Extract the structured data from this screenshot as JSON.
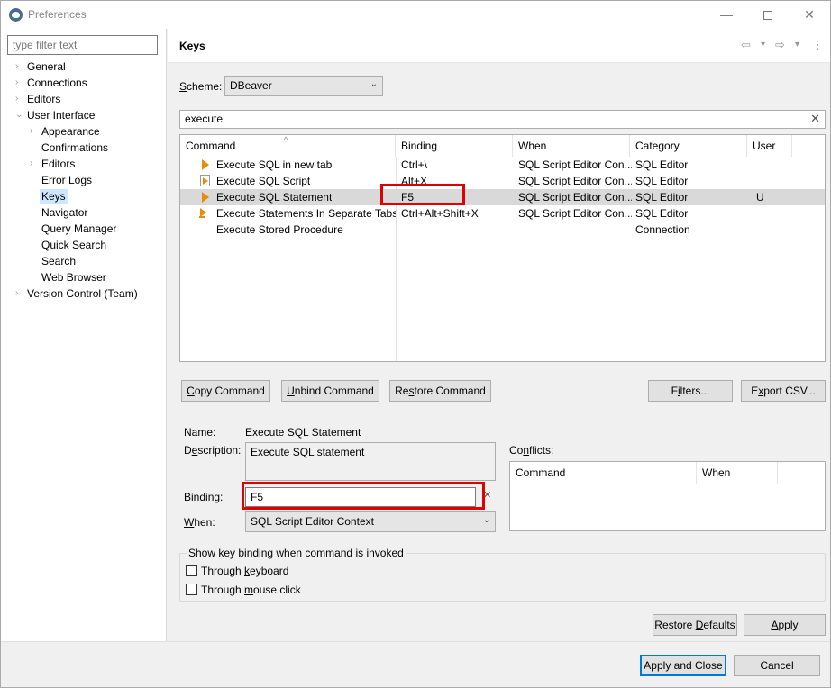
{
  "window": {
    "title": "Preferences",
    "controls": {
      "minimize": "—",
      "close": "✕"
    }
  },
  "sidebar": {
    "filter_placeholder": "type filter text",
    "items": [
      {
        "label": "General",
        "arrow": "›"
      },
      {
        "label": "Connections",
        "arrow": "›"
      },
      {
        "label": "Editors",
        "arrow": "›"
      },
      {
        "label": "User Interface",
        "arrow": "⌄"
      },
      {
        "label": "Appearance",
        "arrow": "›"
      },
      {
        "label": "Confirmations"
      },
      {
        "label": "Editors",
        "arrow": "›"
      },
      {
        "label": "Error Logs"
      },
      {
        "label": "Keys"
      },
      {
        "label": "Navigator"
      },
      {
        "label": "Query Manager"
      },
      {
        "label": "Quick Search"
      },
      {
        "label": "Search"
      },
      {
        "label": "Web Browser"
      },
      {
        "label": "Version Control (Team)",
        "arrow": "›"
      }
    ]
  },
  "page": {
    "title": "Keys",
    "nav_icons": {
      "back": "⇦",
      "forward": "⇨",
      "dropdown": "▾",
      "menu": "⋮"
    }
  },
  "scheme": {
    "label_prefix": "",
    "label_u": "S",
    "label_rest": "cheme:",
    "value": "DBeaver",
    "arrow": "⌄"
  },
  "search": {
    "value": "execute",
    "clear": "✕"
  },
  "table": {
    "sort_indicator": "^",
    "columns": [
      "Command",
      "Binding",
      "When",
      "Category",
      "User"
    ],
    "rows": [
      {
        "icon": "play-icon",
        "command": "Execute SQL in new tab",
        "binding": "Ctrl+\\",
        "when": "SQL Script Editor Con...",
        "category": "SQL Editor",
        "user": ""
      },
      {
        "icon": "script-icon",
        "command": "Execute SQL Script",
        "binding": "Alt+X",
        "when": "SQL Script Editor Con...",
        "category": "SQL Editor",
        "user": ""
      },
      {
        "icon": "play-icon",
        "command": "Execute SQL Statement",
        "binding": "F5",
        "when": "SQL Script Editor Con...",
        "category": "SQL Editor",
        "user": "U"
      },
      {
        "icon": "multi-icon",
        "command": "Execute Statements In Separate Tabs",
        "binding": "Ctrl+Alt+Shift+X",
        "when": "SQL Script Editor Con...",
        "category": "SQL Editor",
        "user": ""
      },
      {
        "icon": "",
        "command": "Execute Stored Procedure",
        "binding": "",
        "when": "",
        "category": "Connection",
        "user": ""
      }
    ]
  },
  "buttons": {
    "copy_u": "C",
    "copy_rest": "opy Command",
    "unbind_u": "U",
    "unbind_rest": "nbind Command",
    "restore_pre": "Re",
    "restore_u": "s",
    "restore_rest": "tore Command",
    "filters_pre": "F",
    "filters_u": "i",
    "filters_rest": "lters...",
    "export_pre": "E",
    "export_u": "x",
    "export_rest": "port CSV..."
  },
  "details": {
    "name_label": "Name:",
    "name_value": "Execute SQL Statement",
    "description_label_pre": "D",
    "description_label_u": "e",
    "description_label_rest": "scription:",
    "description_value": "Execute SQL statement",
    "binding_label_pre": "",
    "binding_label_u": "B",
    "binding_label_rest": "inding:",
    "binding_value": "F5",
    "binding_clear": "✕",
    "when_label_pre": "",
    "when_label_u": "W",
    "when_label_rest": "hen:",
    "when_value": "SQL Script Editor Context",
    "when_arrow": "⌄",
    "conflicts_label_pre": "Co",
    "conflicts_label_u": "n",
    "conflicts_label_rest": "flicts:",
    "conflicts_columns": [
      "Command",
      "When"
    ]
  },
  "show_binding": {
    "title": "Show key binding when command is invoked",
    "keyboard_pre": "Through ",
    "keyboard_u": "k",
    "keyboard_rest": "eyboard",
    "mouse_pre": "Through ",
    "mouse_u": "m",
    "mouse_rest": "ouse click"
  },
  "footer": {
    "restore_defaults_pre": "Restore ",
    "restore_defaults_u": "D",
    "restore_defaults_rest": "efaults",
    "apply_u": "A",
    "apply_rest": "pply",
    "apply_close": "Apply and Close",
    "cancel": "Cancel"
  },
  "colors": {
    "highlight": "#e00000",
    "selection": "#cce8ff",
    "icon_orange": "#e88c0c"
  }
}
